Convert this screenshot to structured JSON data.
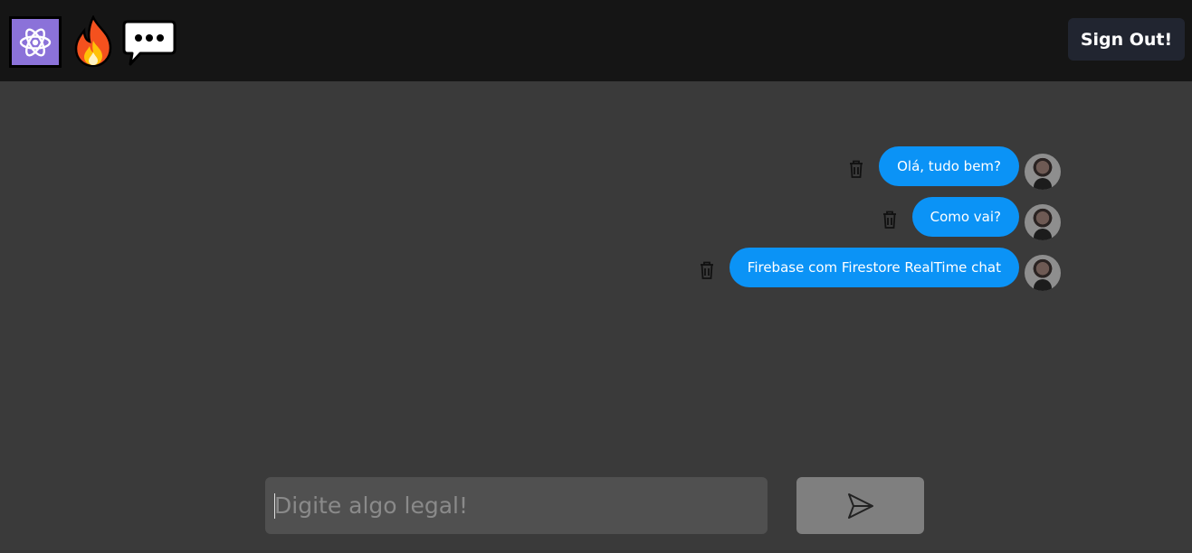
{
  "header": {
    "logos": [
      "atom-icon",
      "fire-icon",
      "chat-bubble-icon"
    ],
    "signout_label": "Sign Out!"
  },
  "messages": [
    {
      "text": "Olá, tudo bem?"
    },
    {
      "text": "Como vai?"
    },
    {
      "text": "Firebase com Firestore RealTime chat"
    }
  ],
  "composer": {
    "placeholder": "Digite algo legal!",
    "send_icon": "send-icon"
  },
  "colors": {
    "header_bg": "#151515",
    "page_bg": "#3a3a3a",
    "bubble": "#0b93f6",
    "signout_bg": "#212530",
    "input_bg": "#505050",
    "send_bg": "#7f7f7f"
  }
}
